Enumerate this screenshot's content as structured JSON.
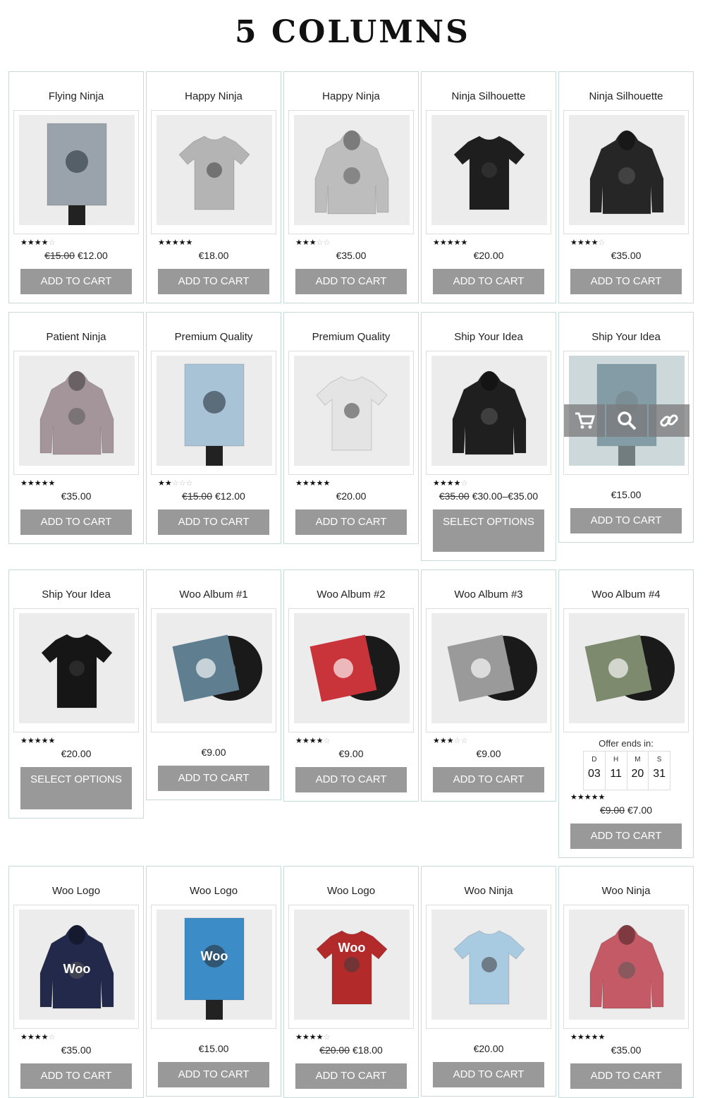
{
  "page": {
    "title": "5 COLUMNS"
  },
  "products": [
    {
      "title": "Flying Ninja",
      "kind": "poster-ninja",
      "color": "#9aa3ab",
      "rating": 4,
      "old_price": "€15.00",
      "price": "€12.00",
      "button": "ADD TO CART"
    },
    {
      "title": "Happy Ninja",
      "kind": "tshirt",
      "color": "#b4b4b4",
      "rating": 5,
      "old_price": "",
      "price": "€18.00",
      "button": "ADD TO CART"
    },
    {
      "title": "Happy Ninja",
      "kind": "hoodie",
      "color": "#bdbdbd",
      "rating": 3,
      "old_price": "",
      "price": "€35.00",
      "button": "ADD TO CART"
    },
    {
      "title": "Ninja Silhouette",
      "kind": "tshirt",
      "color": "#1e1e1e",
      "rating": 5,
      "old_price": "",
      "price": "€20.00",
      "button": "ADD TO CART"
    },
    {
      "title": "Ninja Silhouette",
      "kind": "hoodie",
      "color": "#262626",
      "rating": 4,
      "old_price": "",
      "price": "€35.00",
      "button": "ADD TO CART"
    },
    {
      "title": "Patient Ninja",
      "kind": "hoodie",
      "color": "#a4959a",
      "rating": 5,
      "old_price": "",
      "price": "€35.00",
      "button": "ADD TO CART"
    },
    {
      "title": "Premium Quality",
      "kind": "poster",
      "color": "#a9c3d6",
      "rating": 2,
      "old_price": "€15.00",
      "price": "€12.00",
      "button": "ADD TO CART"
    },
    {
      "title": "Premium Quality",
      "kind": "tshirt",
      "color": "#e4e4e4",
      "rating": 4.5,
      "old_price": "",
      "price": "€20.00",
      "button": "ADD TO CART"
    },
    {
      "title": "Ship Your Idea",
      "kind": "hoodie",
      "color": "#1f1f1f",
      "rating": 4,
      "old_price": "€35.00",
      "price": "€30.00–€35.00",
      "button": "SELECT OPTIONS"
    },
    {
      "title": "Ship Your Idea",
      "kind": "poster",
      "color": "#4a6775",
      "rating": 0,
      "old_price": "",
      "price": "€15.00",
      "button": "ADD TO CART",
      "hover": true
    },
    {
      "title": "Ship Your Idea",
      "kind": "tshirt",
      "color": "#161616",
      "rating": 4.5,
      "old_price": "",
      "price": "€20.00",
      "button": "SELECT OPTIONS"
    },
    {
      "title": "Woo Album #1",
      "kind": "album",
      "color": "#5f7f90",
      "rating": 0,
      "old_price": "",
      "price": "€9.00",
      "button": "ADD TO CART"
    },
    {
      "title": "Woo Album #2",
      "kind": "album",
      "color": "#c9343a",
      "rating": 4,
      "old_price": "",
      "price": "€9.00",
      "button": "ADD TO CART"
    },
    {
      "title": "Woo Album #3",
      "kind": "album",
      "color": "#9a9a9a",
      "rating": 3,
      "old_price": "",
      "price": "€9.00",
      "button": "ADD TO CART"
    },
    {
      "title": "Woo Album #4",
      "kind": "album",
      "color": "#7e8a6e",
      "rating": 5,
      "old_price": "€9.00",
      "price": "€7.00",
      "button": "ADD TO CART",
      "offer": true
    },
    {
      "title": "Woo Logo",
      "kind": "hoodie",
      "color": "#23294a",
      "rating": 4,
      "old_price": "",
      "price": "€35.00",
      "button": "ADD TO CART",
      "label": "Woo"
    },
    {
      "title": "Woo Logo",
      "kind": "poster",
      "color": "#3c8cc8",
      "rating": 0,
      "old_price": "",
      "price": "€15.00",
      "button": "ADD TO CART",
      "label": "Woo"
    },
    {
      "title": "Woo Logo",
      "kind": "tshirt",
      "color": "#b32a2a",
      "rating": 4,
      "old_price": "€20.00",
      "price": "€18.00",
      "button": "ADD TO CART",
      "label": "Woo"
    },
    {
      "title": "Woo Ninja",
      "kind": "tshirt",
      "color": "#a9cbe2",
      "rating": 0,
      "old_price": "",
      "price": "€20.00",
      "button": "ADD TO CART"
    },
    {
      "title": "Woo Ninja",
      "kind": "hoodie",
      "color": "#c35a65",
      "rating": 4.5,
      "old_price": "",
      "price": "€35.00",
      "button": "ADD TO CART"
    }
  ],
  "offer": {
    "label": "Offer ends in:",
    "units": [
      {
        "label": "D",
        "value": "03"
      },
      {
        "label": "H",
        "value": "11"
      },
      {
        "label": "M",
        "value": "20"
      },
      {
        "label": "S",
        "value": "31"
      }
    ]
  },
  "overlay_icons": [
    "cart-icon",
    "search-icon",
    "link-icon"
  ]
}
